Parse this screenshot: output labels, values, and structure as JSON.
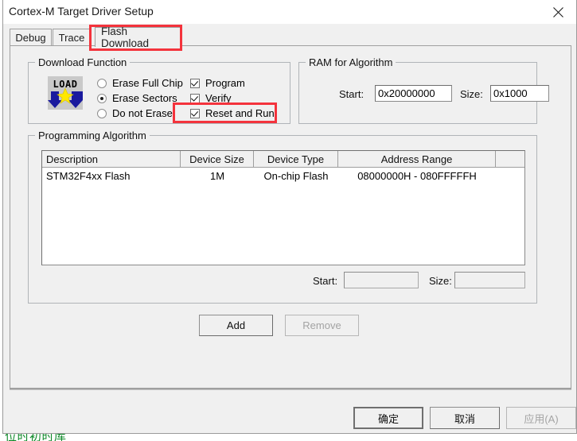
{
  "window": {
    "title": "Cortex-M Target Driver Setup",
    "close_icon": "close-icon"
  },
  "background": {
    "cut_off_text": "位时初时库"
  },
  "tabs": [
    {
      "label": "Debug",
      "active": false
    },
    {
      "label": "Trace",
      "active": false
    },
    {
      "label": "Flash Download",
      "active": true
    }
  ],
  "download_function": {
    "title": "Download Function",
    "icon": "load-icon",
    "icon_text": "LOAD",
    "radios": [
      {
        "label": "Erase Full Chip",
        "checked": false
      },
      {
        "label": "Erase Sectors",
        "checked": true
      },
      {
        "label": "Do not Erase",
        "checked": false
      }
    ],
    "checkboxes": [
      {
        "label": "Program",
        "checked": true
      },
      {
        "label": "Verify",
        "checked": true
      },
      {
        "label": "Reset and Run",
        "checked": true
      }
    ]
  },
  "ram_for_algorithm": {
    "title": "RAM for Algorithm",
    "start_label": "Start:",
    "start_value": "0x20000000",
    "size_label": "Size:",
    "size_value": "0x1000"
  },
  "programming_algorithm": {
    "title": "Programming Algorithm",
    "columns": [
      "Description",
      "Device Size",
      "Device Type",
      "Address Range",
      ""
    ],
    "rows": [
      {
        "description": "STM32F4xx Flash",
        "device_size": "1M",
        "device_type": "On-chip Flash",
        "address_range": "08000000H - 080FFFFFH",
        "extra": ""
      }
    ],
    "start_label": "Start:",
    "start_value": "",
    "size_label": "Size:",
    "size_value": "",
    "add_button": "Add",
    "remove_button": "Remove",
    "remove_disabled": true
  },
  "footer": {
    "ok_button": "确定",
    "cancel_button": "取消",
    "apply_button": "应用(A)",
    "apply_disabled": true
  },
  "colors": {
    "annotation_red": "#f4333c",
    "dialog_face": "#f0f0f0",
    "icon_blue": "#1a1a9e",
    "icon_yellow": "#ffe800",
    "background_text_green": "#0f8a2a"
  },
  "annotations": [
    {
      "name": "flash-download-tab-highlight",
      "target": "Flash Download"
    },
    {
      "name": "reset-and-run-highlight",
      "target": "Reset and Run"
    }
  ]
}
